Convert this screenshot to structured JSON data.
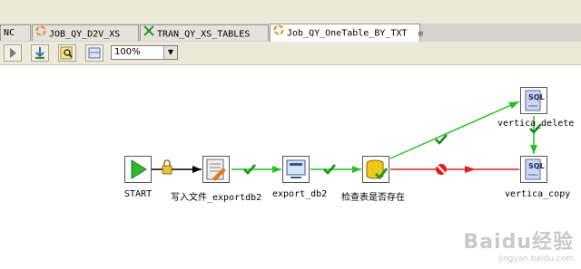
{
  "tabs": [
    {
      "label": "NC"
    },
    {
      "label": "JOB_QY_D2V_XS"
    },
    {
      "label": "TRAN_QY_XS_TABLES"
    },
    {
      "label": "Job_QY_OneTable_BY_TXT"
    }
  ],
  "active_tab_close": "⊠",
  "toolbar": {
    "zoom_value": "100%"
  },
  "nodes": {
    "start": "START",
    "write_file": "写入文件_exportdb2",
    "export_db2": "export_db2",
    "check_table": "检查表是否存在",
    "vertica_delete": "vertica_delete",
    "vertica_copy": "vertica_copy",
    "sql_text": "SQL"
  },
  "watermark": {
    "brand": "Baidu经验",
    "url": "jingyan.baidu.com"
  },
  "colors": {
    "success": "#22c022",
    "failure": "#e02020"
  }
}
